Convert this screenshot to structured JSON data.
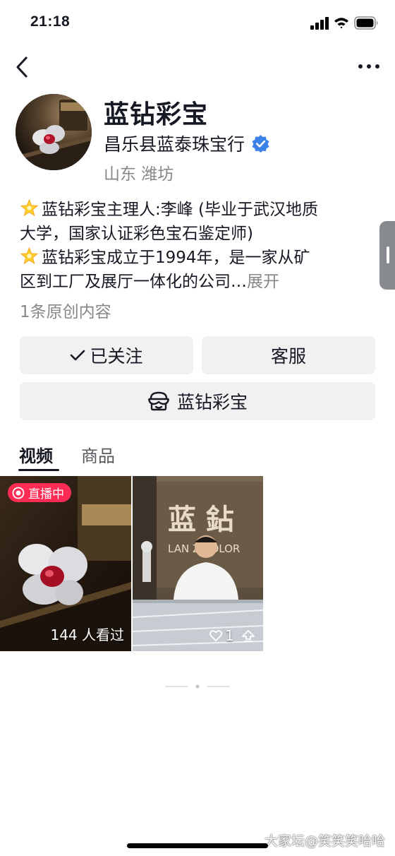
{
  "status_bar": {
    "time": "21:18",
    "icons": [
      "signal-icon",
      "wifi-icon",
      "battery-icon"
    ]
  },
  "nav": {
    "back_icon": "chevron-left-icon",
    "more_icon": "ellipsis-icon"
  },
  "profile": {
    "name": "蓝钻彩宝",
    "company": "昌乐县蓝泰珠宝行",
    "verified_icon": "verified-badge-icon",
    "location": "山东 潍坊",
    "bio": {
      "line1": "蓝钻彩宝主理人:李峰 (毕业于武汉地质",
      "line2": "大学，国家认证彩色宝石鉴定师)",
      "line3": "蓝钻彩宝成立于1994年，是一家从矿",
      "line4": "区到工厂及展厅一体化的公司…",
      "expand": "展开"
    },
    "original_count": "1条原创内容"
  },
  "actions": {
    "follow_label": "已关注",
    "service_label": "客服",
    "store_label": "蓝钻彩宝"
  },
  "tabs": [
    {
      "label": "视频",
      "active": true
    },
    {
      "label": "商品",
      "active": false
    }
  ],
  "videos": [
    {
      "badge": "直播中",
      "views": "144 人看过"
    },
    {
      "likes": "1"
    }
  ],
  "watermark": "大家坛@笑笑笑哈哈",
  "colors": {
    "accent_live": "#fe2c55",
    "verified_blue": "#3b82e8",
    "button_bg": "#f1f1f2",
    "muted_text": "#86878b"
  }
}
